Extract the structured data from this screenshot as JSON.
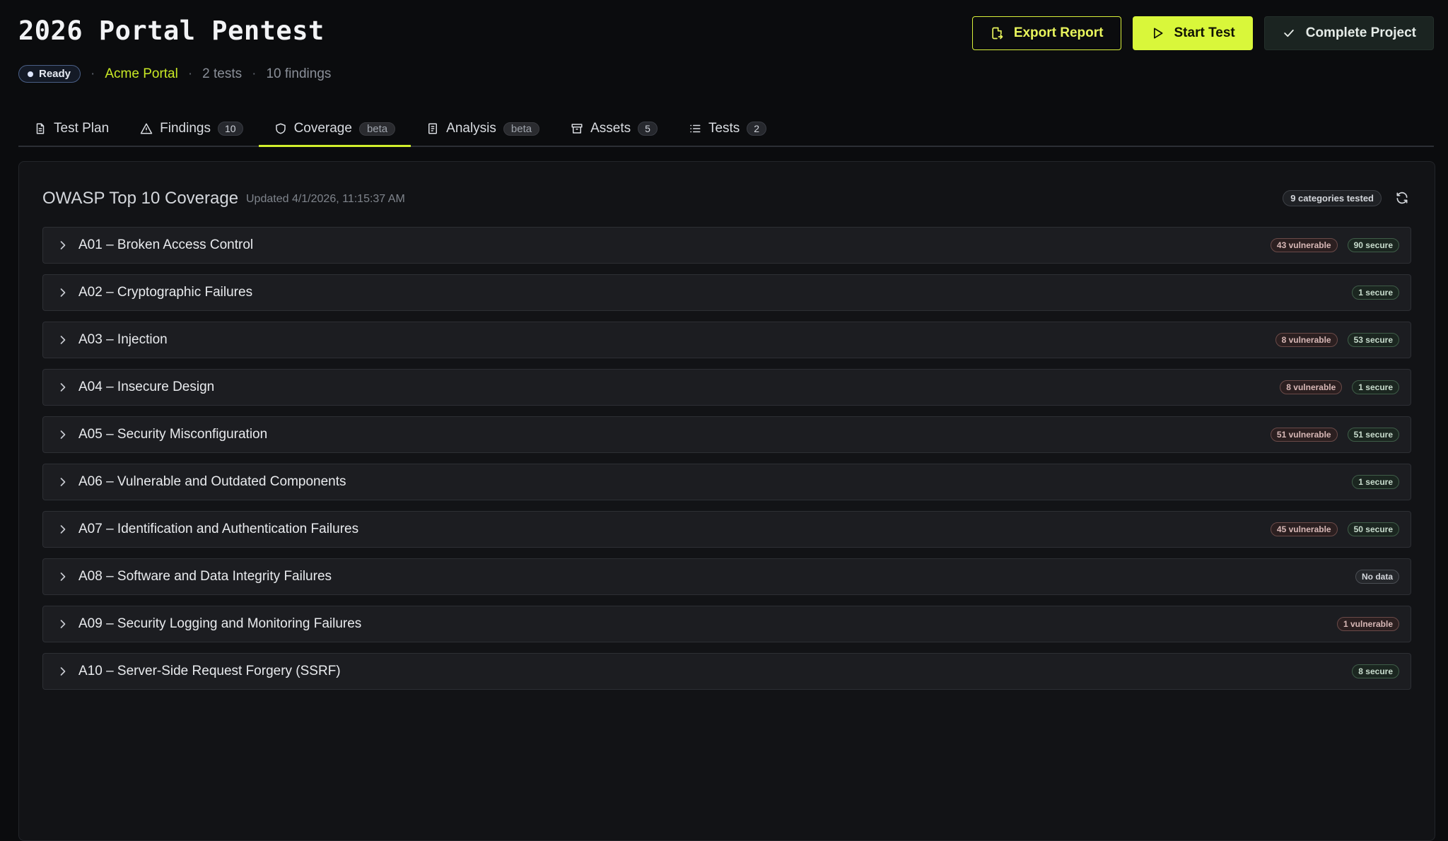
{
  "header": {
    "title": "2026 Portal Pentest",
    "status": "Ready",
    "project": "Acme Portal",
    "tests": "2 tests",
    "findings": "10 findings",
    "separator": "·"
  },
  "actions": {
    "export": "Export Report",
    "start": "Start Test",
    "complete": "Complete Project"
  },
  "tabs": [
    {
      "label": "Test Plan",
      "icon": "document-icon"
    },
    {
      "label": "Findings",
      "count": "10",
      "icon": "warning-icon"
    },
    {
      "label": "Coverage",
      "beta": "beta",
      "icon": "shield-icon",
      "active": true
    },
    {
      "label": "Analysis",
      "beta": "beta",
      "icon": "notes-icon"
    },
    {
      "label": "Assets",
      "count": "5",
      "icon": "archive-icon"
    },
    {
      "label": "Tests",
      "count": "2",
      "icon": "list-icon"
    }
  ],
  "panel": {
    "title": "OWASP Top 10 Coverage",
    "updated": "Updated 4/1/2026, 11:15:37 AM",
    "categories_badge": "9 categories tested"
  },
  "categories": [
    {
      "label": "A01 – Broken Access Control",
      "vulnerable": "43 vulnerable",
      "secure": "90 secure"
    },
    {
      "label": "A02 – Cryptographic Failures",
      "secure": "1 secure"
    },
    {
      "label": "A03 – Injection",
      "vulnerable": "8 vulnerable",
      "secure": "53 secure"
    },
    {
      "label": "A04 – Insecure Design",
      "vulnerable": "8 vulnerable",
      "secure": "1 secure"
    },
    {
      "label": "A05 – Security Misconfiguration",
      "vulnerable": "51 vulnerable",
      "secure": "51 secure"
    },
    {
      "label": "A06 – Vulnerable and Outdated Components",
      "secure": "1 secure"
    },
    {
      "label": "A07 – Identification and Authentication Failures",
      "vulnerable": "45 vulnerable",
      "secure": "50 secure"
    },
    {
      "label": "A08 – Software and Data Integrity Failures",
      "nodata": "No data"
    },
    {
      "label": "A09 – Security Logging and Monitoring Failures",
      "vulnerable": "1 vulnerable"
    },
    {
      "label": "A10 – Server-Side Request Forgery (SSRF)",
      "secure": "8 secure"
    }
  ],
  "colors": {
    "accent": "#d9f73a",
    "background": "#0b0c0e",
    "panel": "#121316",
    "row": "#1c1d21"
  }
}
